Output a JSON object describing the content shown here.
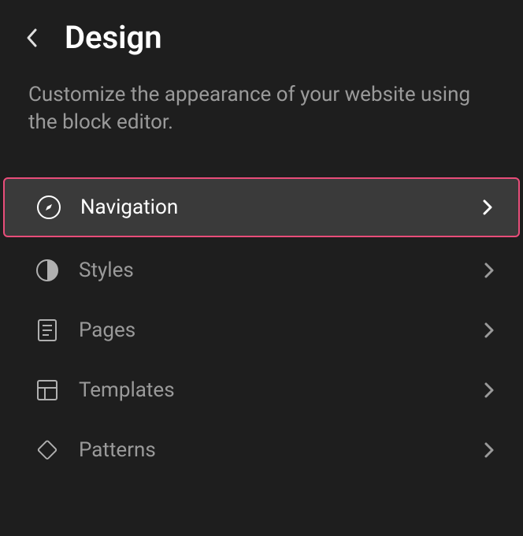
{
  "header": {
    "title": "Design"
  },
  "description": "Customize the appearance of your website using the block editor.",
  "menu": {
    "items": [
      {
        "label": "Navigation",
        "icon": "compass-icon",
        "selected": true
      },
      {
        "label": "Styles",
        "icon": "half-circle-icon",
        "selected": false
      },
      {
        "label": "Pages",
        "icon": "page-icon",
        "selected": false
      },
      {
        "label": "Templates",
        "icon": "layout-icon",
        "selected": false
      },
      {
        "label": "Patterns",
        "icon": "diamond-icon",
        "selected": false
      }
    ]
  }
}
